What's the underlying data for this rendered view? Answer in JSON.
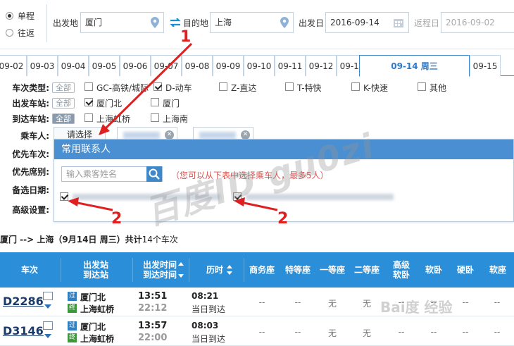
{
  "search": {
    "trip_types": [
      "单程",
      "往返"
    ],
    "from_label": "出发地",
    "from_value": "厦门",
    "to_label": "目的地",
    "to_value": "上海",
    "depart_label": "出发日",
    "depart_value": "2016-09-14",
    "return_label": "返程日",
    "return_value": "2016-09-02"
  },
  "date_tabs": [
    "09-02",
    "09-03",
    "09-04",
    "09-05",
    "09-06",
    "09-07",
    "09-08",
    "09-09",
    "09-10",
    "09-11",
    "09-12",
    "09-13",
    "09-14 周三",
    "09-15"
  ],
  "filters": {
    "type_label": "车次类型:",
    "all_label": "全部",
    "types": [
      "GC-高铁/城际",
      "D-动车",
      "Z-直达",
      "T-特快",
      "K-快速",
      "其他"
    ],
    "from_station_label": "出发车站:",
    "from_stations": [
      "厦门北",
      "厦门"
    ],
    "to_station_label": "到达车站:",
    "to_stations": [
      "上海虹桥",
      "上海南"
    ],
    "passenger_label": "乘车人:",
    "choose_label": "请选择",
    "priority_train_label": "优先车次:",
    "priority_seat_label": "优先席别:",
    "alt_date_label": "备选日期:",
    "advanced_label": "高级设置:"
  },
  "popup": {
    "title": "常用联系人",
    "search_placeholder": "输入乘客姓名",
    "hint": "（您可以从下表中选择乘车人，最多5人）"
  },
  "summary": {
    "route": "厦门 --> 上海（9月14日 周三）共计",
    "count": "14",
    "suffix": "个车次"
  },
  "table": {
    "headers": {
      "train": "车次",
      "station_top": "出发站",
      "station_bottom": "到达站",
      "time_top": "出发时间",
      "time_bottom": "到达时间",
      "duration": "历时",
      "business": "商务座",
      "special": "特等座",
      "first": "一等座",
      "second": "二等座",
      "soft_sleeper_top": "高级",
      "soft_sleeper_bottom": "软卧",
      "soft_sleep": "软卧",
      "hard_sleep": "硬卧",
      "soft_seat": "软座"
    },
    "rows": [
      {
        "train": "D2286",
        "from_badge": "过",
        "from": "厦门北",
        "to_badge": "终",
        "to": "上海虹桥",
        "depart": "13:51",
        "arrive": "22:12",
        "duration": "08:21",
        "arrive_note": "当日到达",
        "business": "--",
        "special": "--",
        "first": "无",
        "second": "无",
        "gs": "--",
        "rw": "--",
        "yw": "--",
        "rz": "--"
      },
      {
        "train": "D3146",
        "from_badge": "过",
        "from": "厦门北",
        "to_badge": "终",
        "to": "上海虹桥",
        "depart": "13:57",
        "arrive": "22:00",
        "duration": "08:03",
        "arrive_note": "当日到达",
        "business": "--",
        "special": "--",
        "first": "无",
        "second": "无",
        "gs": "--",
        "rw": "--",
        "yw": "--",
        "rz": "--"
      }
    ]
  },
  "annotations": {
    "one": "1",
    "two_a": "2",
    "two_b": "2"
  },
  "watermark": "百度ID gu0zi",
  "baidu_mark": "Bai度 经验",
  "colors": {
    "header_blue": "#2a8fd8",
    "popup_blue": "#4a8fd2",
    "arrow_red": "#e02020"
  }
}
